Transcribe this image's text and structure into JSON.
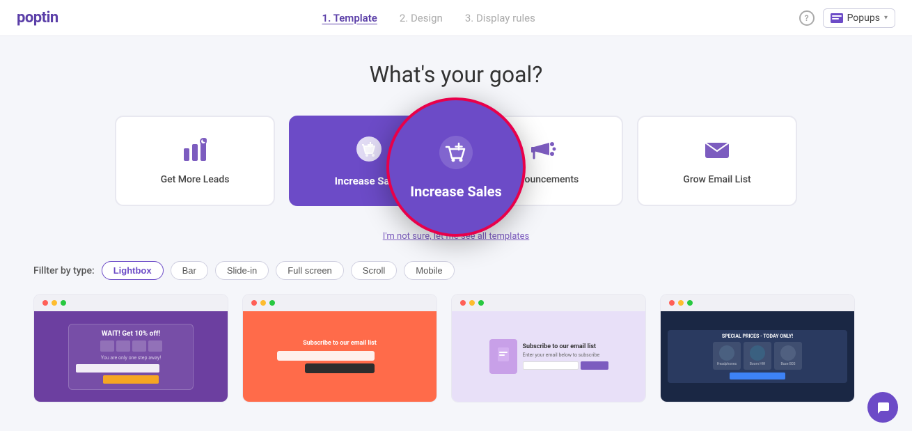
{
  "header": {
    "logo": "poptin",
    "steps": [
      {
        "label": "1. Template",
        "active": true
      },
      {
        "label": "2. Design",
        "active": false
      },
      {
        "label": "3. Display rules",
        "active": false
      }
    ],
    "help_label": "?",
    "popups_label": "Popups"
  },
  "main": {
    "title": "What's your goal?",
    "goal_cards": [
      {
        "id": "leads",
        "label": "Get More Leads",
        "icon": "leads",
        "selected": false
      },
      {
        "id": "sales",
        "label": "Increase Sales",
        "icon": "sales",
        "selected": true
      },
      {
        "id": "announcements",
        "label": "Announcements",
        "icon": "announce",
        "selected": false
      },
      {
        "id": "email",
        "label": "Grow Email List",
        "icon": "email",
        "selected": false
      }
    ],
    "skip_text": "I'm not sure, let me see all templates",
    "filter": {
      "label": "Fillter by type:",
      "options": [
        {
          "label": "Lightbox",
          "active": true
        },
        {
          "label": "Bar",
          "active": false
        },
        {
          "label": "Slide-in",
          "active": false
        },
        {
          "label": "Full screen",
          "active": false
        },
        {
          "label": "Scroll",
          "active": false
        },
        {
          "label": "Mobile",
          "active": false
        }
      ]
    },
    "circle_overlay": {
      "label": "Increase Sales"
    },
    "templates": [
      {
        "id": "t1",
        "type": "coupon"
      },
      {
        "id": "t2",
        "type": "subscribe-coral"
      },
      {
        "id": "t3",
        "type": "subscribe-light"
      },
      {
        "id": "t4",
        "type": "tech-dark"
      }
    ]
  }
}
